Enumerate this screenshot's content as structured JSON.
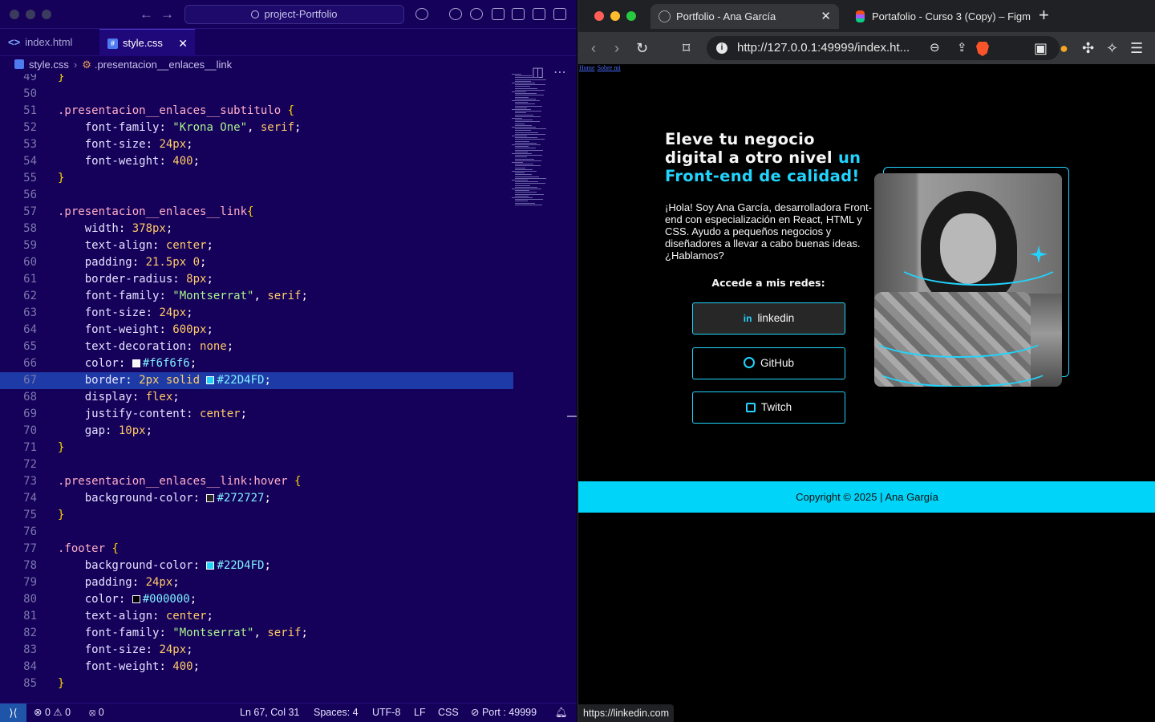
{
  "vscode": {
    "search": "project-Portfolio",
    "tabs": [
      {
        "label": "index.html"
      },
      {
        "label": "style.css"
      }
    ],
    "breadcrumb": {
      "file": "style.css",
      "symbol": ".presentacion__enlaces__link"
    },
    "lines": [
      {
        "n": "49",
        "code": [
          {
            "t": "}",
            "c": "br"
          }
        ]
      },
      {
        "n": "50",
        "code": []
      },
      {
        "n": "51",
        "code": [
          {
            "t": ".presentacion__enlaces__subtitulo ",
            "c": "sel"
          },
          {
            "t": "{",
            "c": "br"
          }
        ]
      },
      {
        "n": "52",
        "code": [
          {
            "t": "    font-family",
            "c": "prop"
          },
          {
            "t": ": ",
            "c": "p"
          },
          {
            "t": "\"Krona One\"",
            "c": "str"
          },
          {
            "t": ", ",
            "c": "p"
          },
          {
            "t": "serif",
            "c": "val"
          },
          {
            "t": ";",
            "c": "p"
          }
        ]
      },
      {
        "n": "53",
        "code": [
          {
            "t": "    font-size",
            "c": "prop"
          },
          {
            "t": ": ",
            "c": "p"
          },
          {
            "t": "24px",
            "c": "num"
          },
          {
            "t": ";",
            "c": "p"
          }
        ]
      },
      {
        "n": "54",
        "code": [
          {
            "t": "    font-weight",
            "c": "prop"
          },
          {
            "t": ": ",
            "c": "p"
          },
          {
            "t": "400",
            "c": "num"
          },
          {
            "t": ";",
            "c": "p"
          }
        ]
      },
      {
        "n": "55",
        "code": [
          {
            "t": "}",
            "c": "br"
          }
        ]
      },
      {
        "n": "56",
        "code": []
      },
      {
        "n": "57",
        "code": [
          {
            "t": ".presentacion__enlaces__link",
            "c": "sel"
          },
          {
            "t": "{",
            "c": "br"
          }
        ]
      },
      {
        "n": "58",
        "code": [
          {
            "t": "    width",
            "c": "prop"
          },
          {
            "t": ": ",
            "c": "p"
          },
          {
            "t": "378px",
            "c": "num"
          },
          {
            "t": ";",
            "c": "p"
          }
        ]
      },
      {
        "n": "59",
        "code": [
          {
            "t": "    text-align",
            "c": "prop"
          },
          {
            "t": ": ",
            "c": "p"
          },
          {
            "t": "center",
            "c": "val"
          },
          {
            "t": ";",
            "c": "p"
          }
        ]
      },
      {
        "n": "60",
        "code": [
          {
            "t": "    padding",
            "c": "prop"
          },
          {
            "t": ": ",
            "c": "p"
          },
          {
            "t": "21.5px 0",
            "c": "num"
          },
          {
            "t": ";",
            "c": "p"
          }
        ]
      },
      {
        "n": "61",
        "code": [
          {
            "t": "    border-radius",
            "c": "prop"
          },
          {
            "t": ": ",
            "c": "p"
          },
          {
            "t": "8px",
            "c": "num"
          },
          {
            "t": ";",
            "c": "p"
          }
        ]
      },
      {
        "n": "62",
        "code": [
          {
            "t": "    font-family",
            "c": "prop"
          },
          {
            "t": ": ",
            "c": "p"
          },
          {
            "t": "\"Montserrat\"",
            "c": "str"
          },
          {
            "t": ", ",
            "c": "p"
          },
          {
            "t": "serif",
            "c": "val"
          },
          {
            "t": ";",
            "c": "p"
          }
        ]
      },
      {
        "n": "63",
        "code": [
          {
            "t": "    font-size",
            "c": "prop"
          },
          {
            "t": ": ",
            "c": "p"
          },
          {
            "t": "24px",
            "c": "num"
          },
          {
            "t": ";",
            "c": "p"
          }
        ]
      },
      {
        "n": "64",
        "code": [
          {
            "t": "    font-weight",
            "c": "prop"
          },
          {
            "t": ": ",
            "c": "p"
          },
          {
            "t": "600px",
            "c": "num"
          },
          {
            "t": ";",
            "c": "p"
          }
        ]
      },
      {
        "n": "65",
        "code": [
          {
            "t": "    text-decoration",
            "c": "prop"
          },
          {
            "t": ": ",
            "c": "p"
          },
          {
            "t": "none",
            "c": "val"
          },
          {
            "t": ";",
            "c": "p"
          }
        ]
      },
      {
        "n": "66",
        "code": [
          {
            "t": "    color",
            "c": "prop"
          },
          {
            "t": ": ",
            "c": "p"
          },
          {
            "sw": "#f6f6f6"
          },
          {
            "t": "#f6f6f6",
            "c": "col"
          },
          {
            "t": ";",
            "c": "p"
          }
        ]
      },
      {
        "n": "67",
        "hl": true,
        "code": [
          {
            "t": "    border",
            "c": "prop"
          },
          {
            "t": ": ",
            "c": "p"
          },
          {
            "t": "2px solid ",
            "c": "num"
          },
          {
            "sw": "#22D4FD"
          },
          {
            "t": "#22D4FD",
            "c": "col"
          },
          {
            "t": ";",
            "c": "p"
          }
        ]
      },
      {
        "n": "68",
        "code": [
          {
            "t": "    display",
            "c": "prop"
          },
          {
            "t": ": ",
            "c": "p"
          },
          {
            "t": "flex",
            "c": "val"
          },
          {
            "t": ";",
            "c": "p"
          }
        ]
      },
      {
        "n": "69",
        "code": [
          {
            "t": "    justify-content",
            "c": "prop"
          },
          {
            "t": ": ",
            "c": "p"
          },
          {
            "t": "center",
            "c": "val"
          },
          {
            "t": ";",
            "c": "p"
          }
        ]
      },
      {
        "n": "70",
        "code": [
          {
            "t": "    gap",
            "c": "prop"
          },
          {
            "t": ": ",
            "c": "p"
          },
          {
            "t": "10px",
            "c": "num"
          },
          {
            "t": ";",
            "c": "p"
          }
        ]
      },
      {
        "n": "71",
        "code": [
          {
            "t": "}",
            "c": "br"
          }
        ]
      },
      {
        "n": "72",
        "code": []
      },
      {
        "n": "73",
        "code": [
          {
            "t": ".presentacion__enlaces__link:hover ",
            "c": "sel"
          },
          {
            "t": "{",
            "c": "br"
          }
        ]
      },
      {
        "n": "74",
        "code": [
          {
            "t": "    background-color",
            "c": "prop"
          },
          {
            "t": ": ",
            "c": "p"
          },
          {
            "sw": "#272727"
          },
          {
            "t": "#272727",
            "c": "col"
          },
          {
            "t": ";",
            "c": "p"
          }
        ]
      },
      {
        "n": "75",
        "code": [
          {
            "t": "}",
            "c": "br"
          }
        ]
      },
      {
        "n": "76",
        "code": []
      },
      {
        "n": "77",
        "code": [
          {
            "t": ".footer ",
            "c": "sel"
          },
          {
            "t": "{",
            "c": "br"
          }
        ]
      },
      {
        "n": "78",
        "code": [
          {
            "t": "    background-color",
            "c": "prop"
          },
          {
            "t": ": ",
            "c": "p"
          },
          {
            "sw": "#22D4FD"
          },
          {
            "t": "#22D4FD",
            "c": "col"
          },
          {
            "t": ";",
            "c": "p"
          }
        ]
      },
      {
        "n": "79",
        "code": [
          {
            "t": "    padding",
            "c": "prop"
          },
          {
            "t": ": ",
            "c": "p"
          },
          {
            "t": "24px",
            "c": "num"
          },
          {
            "t": ";",
            "c": "p"
          }
        ]
      },
      {
        "n": "80",
        "code": [
          {
            "t": "    color",
            "c": "prop"
          },
          {
            "t": ": ",
            "c": "p"
          },
          {
            "sw": "#000000"
          },
          {
            "t": "#000000",
            "c": "col"
          },
          {
            "t": ";",
            "c": "p"
          }
        ]
      },
      {
        "n": "81",
        "code": [
          {
            "t": "    text-align",
            "c": "prop"
          },
          {
            "t": ": ",
            "c": "p"
          },
          {
            "t": "center",
            "c": "val"
          },
          {
            "t": ";",
            "c": "p"
          }
        ]
      },
      {
        "n": "82",
        "code": [
          {
            "t": "    font-family",
            "c": "prop"
          },
          {
            "t": ": ",
            "c": "p"
          },
          {
            "t": "\"Montserrat\"",
            "c": "str"
          },
          {
            "t": ", ",
            "c": "p"
          },
          {
            "t": "serif",
            "c": "val"
          },
          {
            "t": ";",
            "c": "p"
          }
        ]
      },
      {
        "n": "83",
        "code": [
          {
            "t": "    font-size",
            "c": "prop"
          },
          {
            "t": ": ",
            "c": "p"
          },
          {
            "t": "24px",
            "c": "num"
          },
          {
            "t": ";",
            "c": "p"
          }
        ]
      },
      {
        "n": "84",
        "code": [
          {
            "t": "    font-weight",
            "c": "prop"
          },
          {
            "t": ": ",
            "c": "p"
          },
          {
            "t": "400",
            "c": "num"
          },
          {
            "t": ";",
            "c": "p"
          }
        ]
      },
      {
        "n": "85",
        "code": [
          {
            "t": "}",
            "c": "br"
          }
        ]
      }
    ],
    "status": {
      "problems": "0",
      "warnings": "0",
      "ports_count": "0",
      "cursor": "Ln 67, Col 31",
      "spaces": "Spaces: 4",
      "encoding": "UTF-8",
      "eol": "LF",
      "language": "CSS",
      "port": "Port : 49999"
    }
  },
  "browser": {
    "tabs": [
      {
        "label": "Portfolio - Ana García"
      },
      {
        "label": "Portafolio - Curso 3 (Copy) – Figm"
      }
    ],
    "url": "http://127.0.0.1:49999/index.ht...",
    "status_link": "https://linkedin.com",
    "page": {
      "skip_links": [
        "Home",
        "Sobre mi"
      ],
      "title_line1": "Eleve tu negocio",
      "title_line2": "digital a otro nivel ",
      "title_accent1": "un",
      "title_accent2": "Front-end de calidad!",
      "intro": "¡Hola! Soy Ana García, desarrolladora Front-end con especialización en React, HTML y CSS. Ayudo a pequeños negocios y diseñadores a llevar a cabo buenas ideas. ¿Hablamos?",
      "subtitle": "Accede a mis redes:",
      "links": [
        {
          "label": "linkedin",
          "icon": "linkedin-icon",
          "icon_text": "in"
        },
        {
          "label": "GitHub",
          "icon": "github-icon"
        },
        {
          "label": "Twitch",
          "icon": "twitch-icon"
        }
      ],
      "footer": "Copyright © 2025 | Ana Gargía"
    }
  },
  "colors": {
    "accent": "#22D4FD",
    "editor_bg": "#15005a",
    "hover_bg": "#272727"
  }
}
